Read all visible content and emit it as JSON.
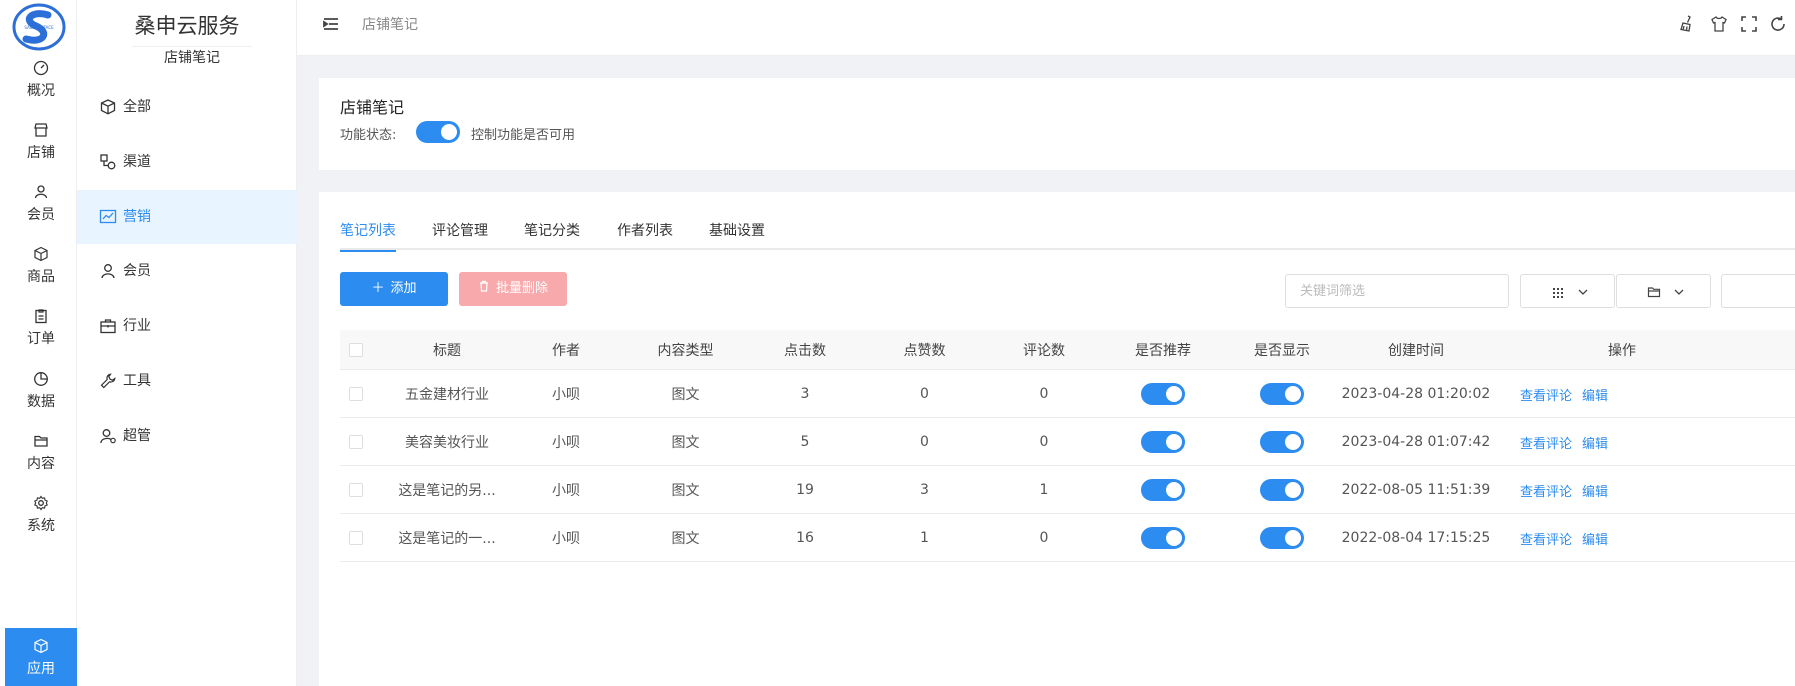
{
  "rail": {
    "items": [
      {
        "label": "概况",
        "icon": "dashboard-icon"
      },
      {
        "label": "店铺",
        "icon": "store-icon"
      },
      {
        "label": "会员",
        "icon": "user-icon"
      },
      {
        "label": "商品",
        "icon": "cube-icon"
      },
      {
        "label": "订单",
        "icon": "clipboard-icon"
      },
      {
        "label": "数据",
        "icon": "pie-chart-icon"
      },
      {
        "label": "内容",
        "icon": "folder-icon"
      },
      {
        "label": "系统",
        "icon": "gear-icon"
      },
      {
        "label": "应用",
        "icon": "cube-icon"
      }
    ]
  },
  "sub": {
    "title": "桑申云服务",
    "subtitle": "店铺笔记",
    "items": [
      {
        "label": "全部"
      },
      {
        "label": "渠道"
      },
      {
        "label": "营销"
      },
      {
        "label": "会员"
      },
      {
        "label": "行业"
      },
      {
        "label": "工具"
      },
      {
        "label": "超管"
      }
    ]
  },
  "topbar": {
    "breadcrumb": "店铺笔记"
  },
  "header": {
    "title": "店铺笔记",
    "status_label": "功能状态:",
    "status_desc": "控制功能是否可用",
    "status_on": true
  },
  "tabs": [
    "笔记列表",
    "评论管理",
    "笔记分类",
    "作者列表",
    "基础设置"
  ],
  "toolbar": {
    "add_label": "添加",
    "batch_delete_label": "批量删除",
    "search_placeholder": "关键词筛选"
  },
  "table": {
    "columns": [
      "标题",
      "作者",
      "内容类型",
      "点击数",
      "点赞数",
      "评论数",
      "是否推荐",
      "是否显示",
      "创建时间",
      "操作"
    ],
    "action_view": "查看评论",
    "action_edit": "编辑",
    "rows": [
      {
        "title": "五金建材行业",
        "author": "小呗",
        "type": "图文",
        "clicks": "3",
        "likes": "0",
        "comments": "0",
        "recommend": true,
        "visible": true,
        "created": "2023-04-28 01:20:02"
      },
      {
        "title": "美容美妆行业",
        "author": "小呗",
        "type": "图文",
        "clicks": "5",
        "likes": "0",
        "comments": "0",
        "recommend": true,
        "visible": true,
        "created": "2023-04-28 01:07:42"
      },
      {
        "title": "这是笔记的另...",
        "author": "小呗",
        "type": "图文",
        "clicks": "19",
        "likes": "3",
        "comments": "1",
        "recommend": true,
        "visible": true,
        "created": "2022-08-05 11:51:39"
      },
      {
        "title": "这是笔记的一...",
        "author": "小呗",
        "type": "图文",
        "clicks": "16",
        "likes": "1",
        "comments": "0",
        "recommend": true,
        "visible": true,
        "created": "2022-08-04 17:15:25"
      }
    ]
  },
  "colors": {
    "primary": "#2d8cf0",
    "danger_disabled": "#f8a9ab",
    "active_bg": "#e8f4ff"
  }
}
